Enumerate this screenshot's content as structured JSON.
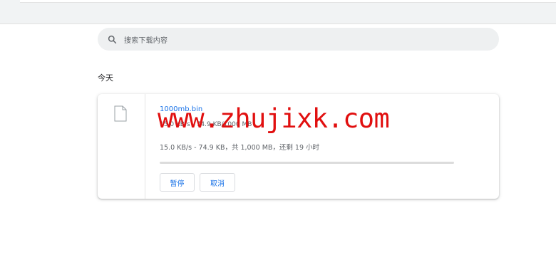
{
  "search": {
    "placeholder": "搜索下载内容",
    "icon": "search-icon"
  },
  "section": {
    "title": "今天"
  },
  "download": {
    "file_name": "1000mb.bin",
    "file_icon": "file-icon",
    "status_text": "15.0 KB/s - 74.9 KB，共 1,000 MB，还剩 19 小时",
    "status_text_obscured": "15.0 KB/s - 74.9 KB/1000 MB",
    "progress_fraction": 0.0001,
    "pause_label": "暂停",
    "cancel_label": "取消"
  },
  "watermark": {
    "text": "www.zhujixk.com"
  },
  "colors": {
    "link_blue": "#1a73e8",
    "watermark_red": "#e10f0f",
    "search_bg": "#eef0f1"
  }
}
